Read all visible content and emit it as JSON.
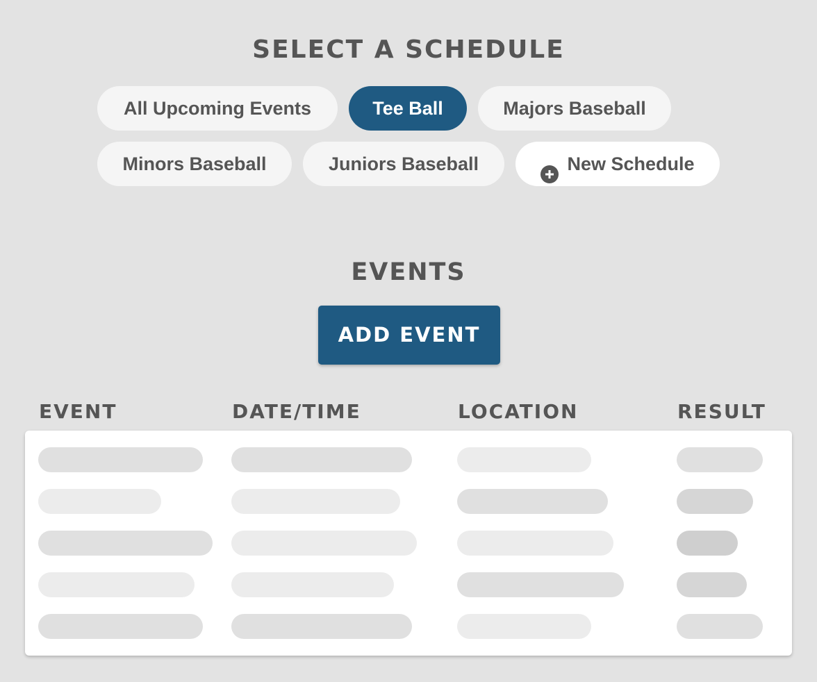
{
  "schedule_section": {
    "title": "SELECT A SCHEDULE",
    "options": [
      {
        "label": "All Upcoming Events",
        "active": false
      },
      {
        "label": "Tee Ball",
        "active": true
      },
      {
        "label": "Majors Baseball",
        "active": false
      },
      {
        "label": "Minors Baseball",
        "active": false
      },
      {
        "label": "Juniors Baseball",
        "active": false
      }
    ],
    "new_schedule_label": "New Schedule",
    "new_schedule_icon": "plus-circle-icon"
  },
  "events_section": {
    "title": "EVENTS",
    "add_button_label": "ADD EVENT",
    "columns": [
      "EVENT",
      "DATE/TIME",
      "LOCATION",
      "RESULT"
    ],
    "rows_loading": true,
    "placeholder_row_count": 5
  },
  "colors": {
    "background": "#e3e3e3",
    "accent": "#1f5a82",
    "text": "#555555",
    "pill_background": "#f5f5f5",
    "card_background": "#ffffff"
  }
}
